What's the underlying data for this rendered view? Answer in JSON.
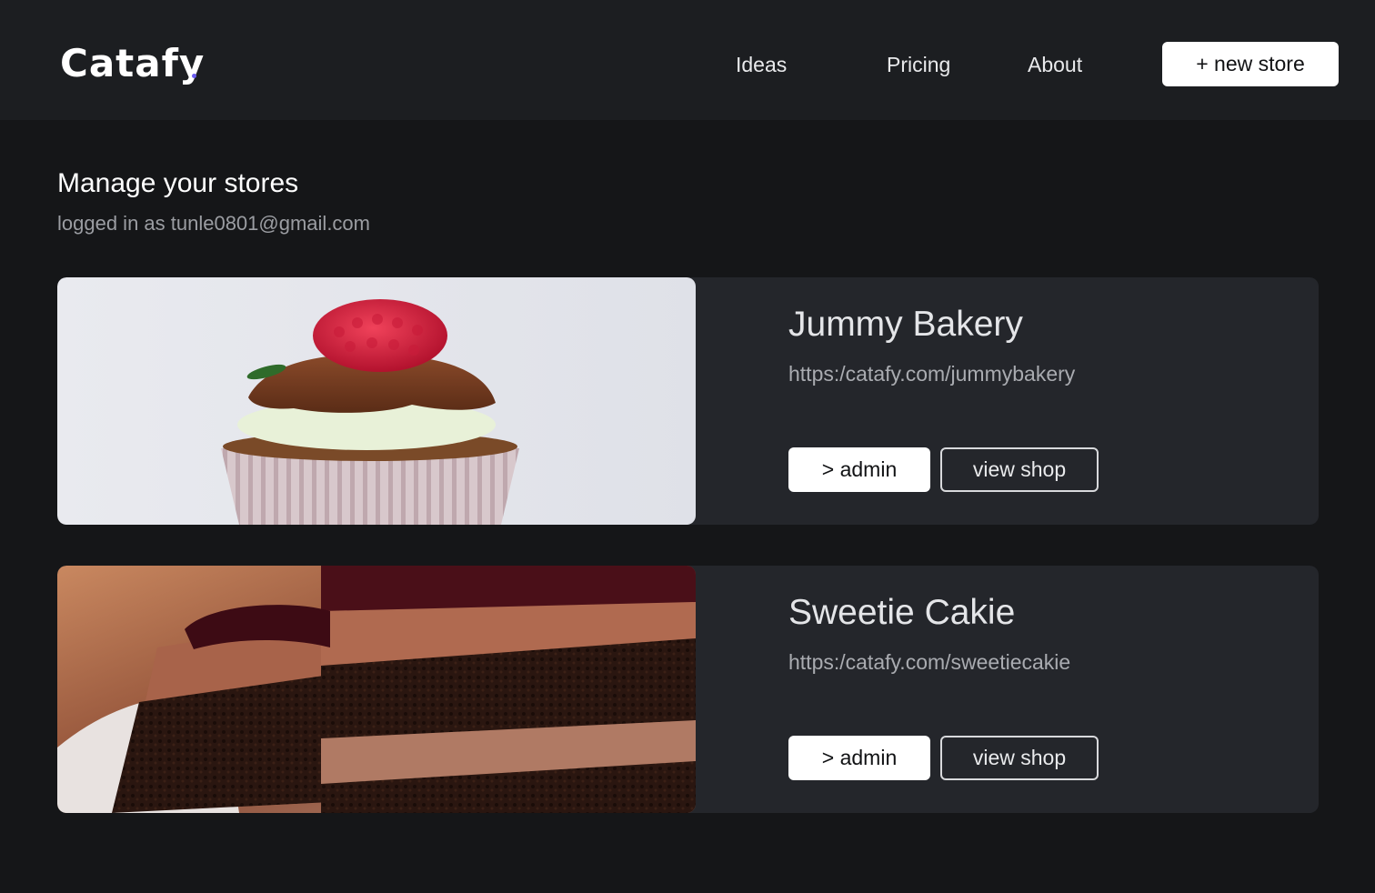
{
  "header": {
    "logo": "Catafy",
    "logo_dot_color": "#6b5cf0",
    "nav": [
      {
        "label": "Ideas"
      },
      {
        "label": "Pricing"
      },
      {
        "label": "About"
      }
    ],
    "new_store_label": "+ new store"
  },
  "main": {
    "title": "Manage your stores",
    "login_info": "logged in as tunle0801@gmail.com",
    "stores": [
      {
        "name": "Jummy Bakery",
        "url": "https:/catafy.com/jummybakery",
        "admin_label": "> admin",
        "view_label": "view shop",
        "image": "cupcake-photo"
      },
      {
        "name": "Sweetie Cakie",
        "url": "https:/catafy.com/sweetiecakie",
        "admin_label": "> admin",
        "view_label": "view shop",
        "image": "chocolate-cake-photo"
      }
    ]
  },
  "colors": {
    "page_background": "#151618",
    "header_background": "#1c1e21",
    "card_background": "#24262b",
    "primary_button": "#ffffff"
  }
}
